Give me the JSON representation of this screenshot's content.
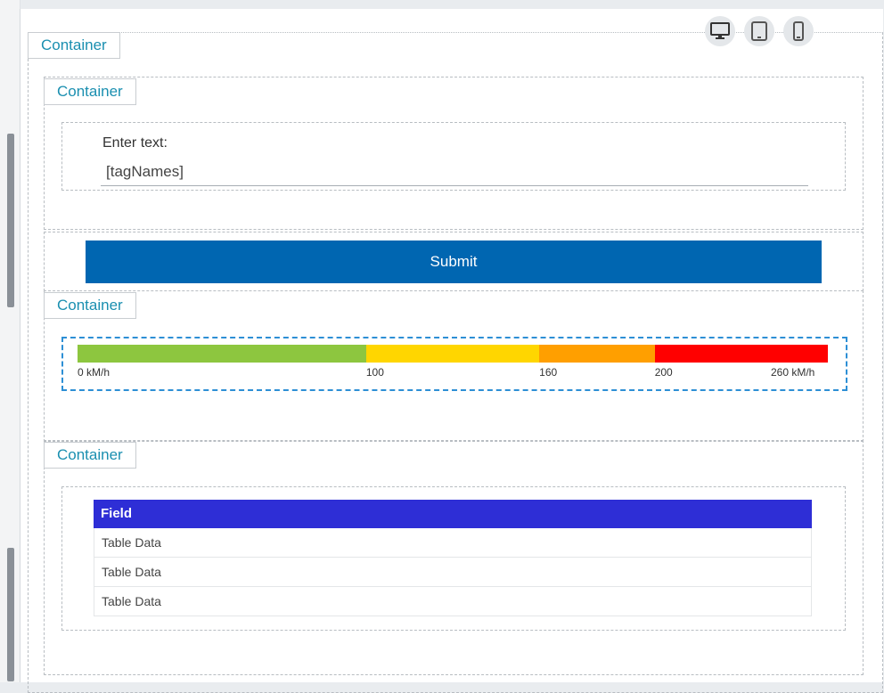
{
  "device_icons": [
    "desktop-icon",
    "tablet-icon",
    "phone-icon"
  ],
  "containers": {
    "outer_label": "Container",
    "input_label": "Container",
    "gauge_label": "Container",
    "table_label": "Container"
  },
  "form": {
    "field_label": "Enter text:",
    "field_value": "[tagNames]",
    "submit_label": "Submit"
  },
  "gauge": {
    "segments": [
      {
        "from": 0,
        "to": 100,
        "color": "#8dc63f"
      },
      {
        "from": 100,
        "to": 160,
        "color": "#ffd600"
      },
      {
        "from": 160,
        "to": 200,
        "color": "#ff9f00"
      },
      {
        "from": 200,
        "to": 260,
        "color": "#ff0000"
      }
    ],
    "ticks": [
      "0 kM/h",
      "100",
      "160",
      "200",
      "260 kM/h"
    ]
  },
  "table": {
    "header": "Field",
    "rows": [
      "Table Data",
      "Table Data",
      "Table Data"
    ]
  },
  "colors": {
    "accent_link": "#1a8fb0",
    "button": "#0066b1",
    "table_header": "#2e2ed6",
    "selection": "#2d8fd5"
  }
}
